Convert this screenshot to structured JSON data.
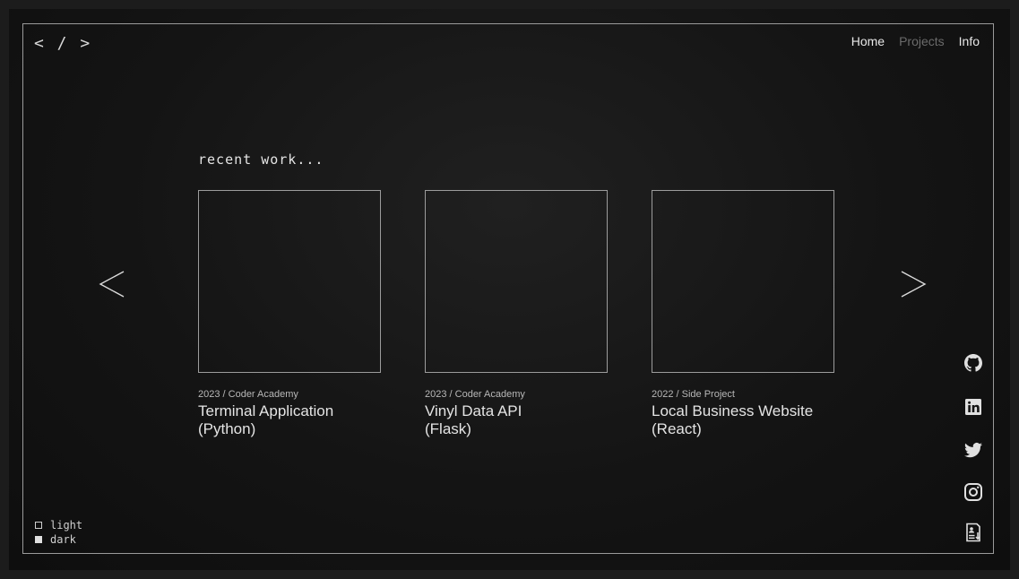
{
  "logo": {
    "text": "< / >"
  },
  "nav": [
    {
      "label": "Home",
      "active": false
    },
    {
      "label": "Projects",
      "active": true
    },
    {
      "label": "Info",
      "active": false
    }
  ],
  "section": {
    "title": "recent work..."
  },
  "carousel": {
    "prev_icon": "chevron-left-icon",
    "next_icon": "chevron-right-icon"
  },
  "projects": [
    {
      "meta": "2023 / Coder Academy",
      "title_line1": "Terminal Application",
      "title_line2": "(Python)"
    },
    {
      "meta": "2023 / Coder Academy",
      "title_line1": "Vinyl Data API",
      "title_line2": "(Flask)"
    },
    {
      "meta": "2022 / Side Project",
      "title_line1": "Local Business Website",
      "title_line2": "(React)"
    }
  ],
  "social": [
    "github-icon",
    "linkedin-icon",
    "twitter-icon",
    "instagram-icon",
    "resume-download-icon"
  ],
  "theme": {
    "options": [
      {
        "label": "light",
        "checked": false
      },
      {
        "label": "dark",
        "checked": true
      }
    ]
  },
  "colors": {
    "background": "#141414",
    "text": "#e4e4e4",
    "muted": "#6b6b6b",
    "border": "#9a9a9a"
  }
}
